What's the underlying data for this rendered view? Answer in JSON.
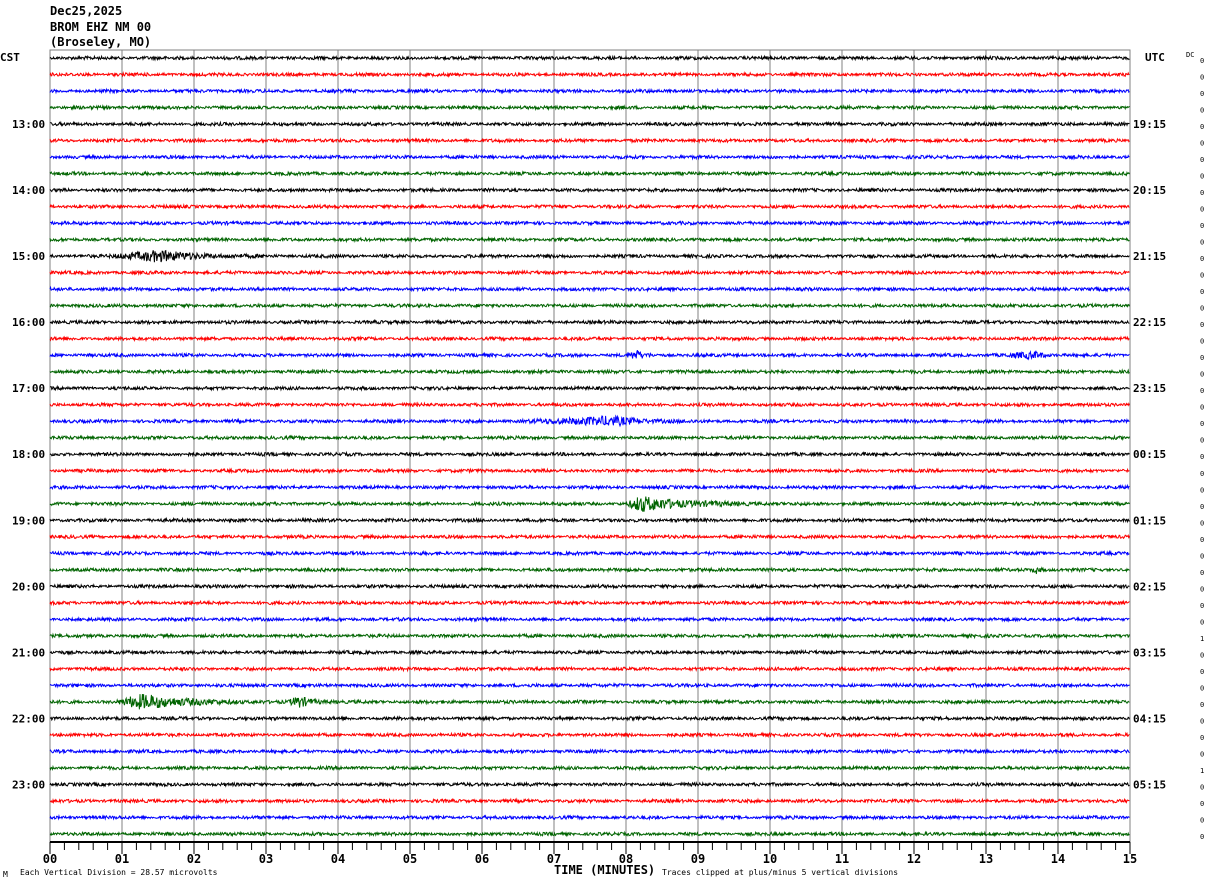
{
  "header": {
    "date": "Dec25,2025",
    "station": "BROM EHZ NM 00",
    "location": "(Broseley, MO)",
    "left_timezone": "CST",
    "right_timezone": "UTC",
    "dc_label": "DC"
  },
  "footer": {
    "scale_note": "Each Vertical Division =   28.57 microvolts",
    "xlabel": "TIME (MINUTES)",
    "clip_note": "Traces clipped at plus/minus 5 vertical divisions",
    "corner_mark": "M"
  },
  "chart_data": {
    "type": "line",
    "title": "",
    "xlabel": "TIME (MINUTES)",
    "xlim": [
      0,
      15
    ],
    "x_ticks": [
      "00",
      "01",
      "02",
      "03",
      "04",
      "05",
      "06",
      "07",
      "08",
      "09",
      "10",
      "11",
      "12",
      "13",
      "14",
      "15"
    ],
    "grid": true,
    "trace_count": 48,
    "trace_minutes": 15,
    "trace_colors": [
      "#000000",
      "#ff0000",
      "#0000ff",
      "#006400"
    ],
    "left_labels": [
      {
        "trace": 4,
        "text": "13:00"
      },
      {
        "trace": 8,
        "text": "14:00"
      },
      {
        "trace": 12,
        "text": "15:00"
      },
      {
        "trace": 16,
        "text": "16:00"
      },
      {
        "trace": 20,
        "text": "17:00"
      },
      {
        "trace": 24,
        "text": "18:00"
      },
      {
        "trace": 28,
        "text": "19:00"
      },
      {
        "trace": 32,
        "text": "20:00"
      },
      {
        "trace": 36,
        "text": "21:00"
      },
      {
        "trace": 40,
        "text": "22:00"
      },
      {
        "trace": 44,
        "text": "23:00"
      }
    ],
    "right_labels": [
      {
        "trace": 4,
        "text": "19:15"
      },
      {
        "trace": 8,
        "text": "20:15"
      },
      {
        "trace": 12,
        "text": "21:15"
      },
      {
        "trace": 16,
        "text": "22:15"
      },
      {
        "trace": 20,
        "text": "23:15"
      },
      {
        "trace": 24,
        "text": "00:15"
      },
      {
        "trace": 28,
        "text": "01:15"
      },
      {
        "trace": 32,
        "text": "02:15"
      },
      {
        "trace": 36,
        "text": "03:15"
      },
      {
        "trace": 40,
        "text": "04:15"
      },
      {
        "trace": 44,
        "text": "05:15"
      }
    ],
    "dc_values": [
      "0",
      "0",
      "0",
      "0",
      "0",
      "0",
      "0",
      "0",
      "0",
      "0",
      "0",
      "0",
      "0",
      "0",
      "0",
      "0",
      "0",
      "0",
      "0",
      "0",
      "0",
      "0",
      "0",
      "0",
      "0",
      "0",
      "0",
      "0",
      "0",
      "0",
      "0",
      "0",
      "0",
      "0",
      "0",
      "1",
      "0",
      "0",
      "0",
      "0",
      "0",
      "0",
      "0",
      "1",
      "0",
      "0",
      "0",
      "0"
    ],
    "events": [
      {
        "trace": 12,
        "start_min": 0.8,
        "peak_min": 1.5,
        "end_min": 3.0,
        "amplitude": 5
      },
      {
        "trace": 18,
        "start_min": 8.0,
        "peak_min": 8.15,
        "end_min": 8.4,
        "amplitude": 4
      },
      {
        "trace": 18,
        "start_min": 13.2,
        "peak_min": 13.7,
        "end_min": 14.0,
        "amplitude": 3
      },
      {
        "trace": 22,
        "start_min": 6.5,
        "peak_min": 7.8,
        "end_min": 9.0,
        "amplitude": 4
      },
      {
        "trace": 27,
        "start_min": 8.0,
        "peak_min": 8.2,
        "end_min": 10.0,
        "amplitude": 7
      },
      {
        "trace": 39,
        "start_min": 0.9,
        "peak_min": 1.3,
        "end_min": 3.0,
        "amplitude": 7
      },
      {
        "trace": 39,
        "start_min": 3.3,
        "peak_min": 3.45,
        "end_min": 4.0,
        "amplitude": 5
      },
      {
        "trace": 31,
        "start_min": 13.6,
        "peak_min": 13.7,
        "end_min": 13.9,
        "amplitude": 3
      }
    ]
  }
}
